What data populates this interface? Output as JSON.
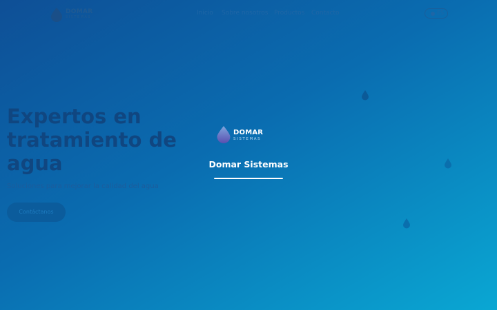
{
  "navbar": {
    "brand": "DOMAR",
    "brand_sub": "SISTEMAS",
    "links": [
      "Inicio",
      "Sobre nosotros",
      "Productos",
      "Contacto"
    ],
    "lang_label": "ES"
  },
  "hero": {
    "title": "Expertos en tratamiento de agua",
    "subtitle": "Soluciones para mejorar la calidad del agua",
    "cta_label": "Contáctanos"
  },
  "loader": {
    "brand": "DOMAR",
    "brand_sub": "SISTEMAS",
    "title": "Domar Sistemas",
    "progress": 1.0
  },
  "colors": {
    "background_start": "#0e4f96",
    "background_end": "#0aa7d3",
    "accent": "#ffffff",
    "drop_light": "#7fa6dd",
    "drop_dark": "#5a4fb0"
  },
  "icons": [
    "water-drop-icon",
    "language-icon"
  ]
}
